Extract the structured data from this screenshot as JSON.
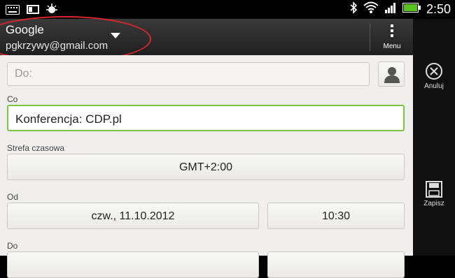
{
  "status": {
    "time": "2:50"
  },
  "account": {
    "name": "Google",
    "email": "pgkrzywy@gmail.com"
  },
  "menu": {
    "label": "Menu"
  },
  "form": {
    "to_placeholder": "Do:",
    "subject_label": "Co",
    "subject_value": "Konferencja: CDP.pl",
    "timezone_label": "Strefa czasowa",
    "timezone_value": "GMT+2:00",
    "from_label": "Od",
    "from_date": "czw., 11.10.2012",
    "from_time": "10:30",
    "to_label": "Do"
  },
  "sidebar": {
    "cancel_label": "Anuluj",
    "save_label": "Zapisz"
  },
  "colors": {
    "focus_green": "#7cc443",
    "battery_green": "#56c41a",
    "highlight_red": "#d8262c"
  }
}
